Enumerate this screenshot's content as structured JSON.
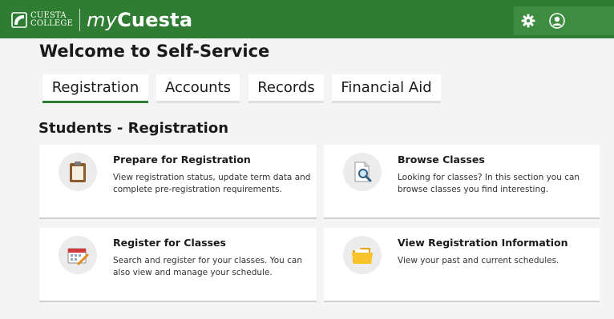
{
  "header": {
    "college_line1": "CUESTA",
    "college_line2": "COLLEGE",
    "brand_prefix": "my",
    "brand_name": "Cuesta"
  },
  "page_title": "Welcome to Self-Service",
  "tabs": [
    {
      "label": "Registration",
      "active": true
    },
    {
      "label": "Accounts",
      "active": false
    },
    {
      "label": "Records",
      "active": false
    },
    {
      "label": "Financial Aid",
      "active": false
    }
  ],
  "section_title": "Students - Registration",
  "cards": [
    {
      "title": "Prepare for Registration",
      "description": "View registration status, update term data and complete pre-registration requirements.",
      "icon": "clipboard-icon"
    },
    {
      "title": "Browse Classes",
      "description": "Looking for classes? In this section you can browse classes you find interesting.",
      "icon": "search-document-icon"
    },
    {
      "title": "Register for Classes",
      "description": "Search and register for your classes. You can also view and manage your schedule.",
      "icon": "calendar-pencil-icon"
    },
    {
      "title": "View Registration Information",
      "description": "View your past and current schedules.",
      "icon": "folder-icon"
    }
  ],
  "colors": {
    "header_green": "#2f7d32",
    "tools_green": "#3d8c3f",
    "active_tab_underline": "#2f7d32"
  }
}
